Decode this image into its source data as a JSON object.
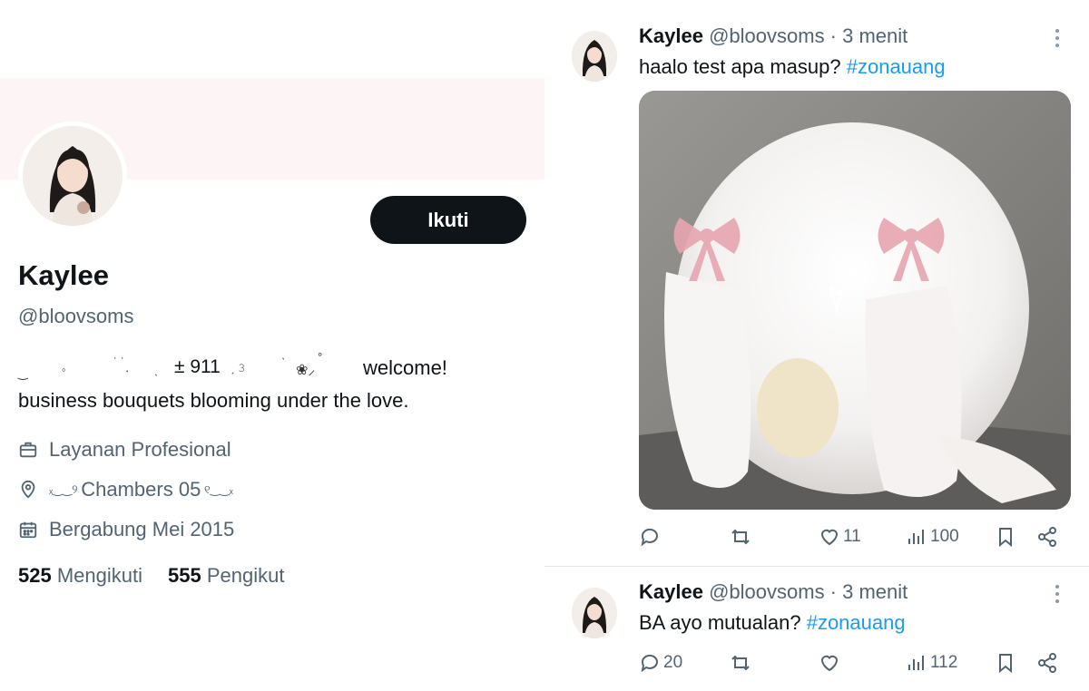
{
  "profile": {
    "follow_label": "Ikuti",
    "display_name": "Kaylee",
    "handle": "@bloovsoms",
    "bio_line1_number": "± 911",
    "bio_line1_welcome": "welcome!",
    "bio_line2": "business bouquets blooming under the love.",
    "category": "Layanan Profesional",
    "location_text": "Chambers 05",
    "joined": "Bergabung Mei 2015",
    "following_count": "525",
    "following_label": "Mengikuti",
    "followers_count": "555",
    "followers_label": "Pengikut",
    "colors": {
      "banner": "#fcf4f5",
      "text_secondary": "#536471",
      "button": "#0f1419"
    }
  },
  "tweets": [
    {
      "name": "Kaylee",
      "handle_time": "@bloovsoms · 3 menit",
      "text": "haalo test apa masup?",
      "hashtag": "#zonauang",
      "likes": "11",
      "views": "100",
      "replies": "",
      "icons": [
        "reply-icon",
        "retweet-icon",
        "like-icon",
        "views-icon",
        "bookmark-icon",
        "share-icon"
      ]
    },
    {
      "name": "Kaylee",
      "handle_time": "@bloovsoms · 3 menit",
      "text": "BA ayo mutualan?",
      "hashtag": "#zonauang",
      "likes": "",
      "views": "112",
      "replies": "20",
      "icons": [
        "reply-icon",
        "retweet-icon",
        "like-icon",
        "views-icon",
        "bookmark-icon",
        "share-icon"
      ]
    }
  ],
  "accent_color": "#1d9bf0"
}
